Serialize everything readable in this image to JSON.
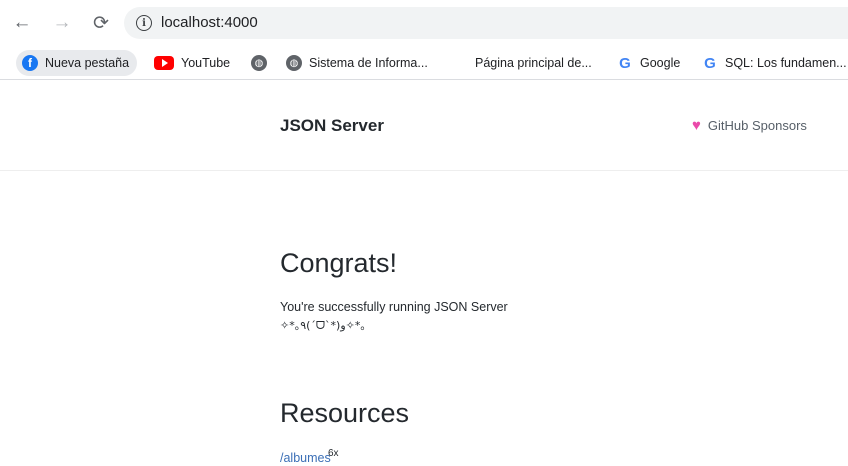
{
  "browser": {
    "url": "localhost:4000",
    "bookmarks": [
      {
        "label": "Nueva pestaña",
        "icon": "facebook-icon"
      },
      {
        "label": "YouTube",
        "icon": "youtube-icon"
      },
      {
        "label": "",
        "icon": "globe-icon"
      },
      {
        "label": "Sistema de Informa...",
        "icon": "globe-icon"
      },
      {
        "label": "Página principal de...",
        "icon": "microsoft-icon"
      },
      {
        "label": "Google",
        "icon": "google-icon"
      },
      {
        "label": "SQL: Los fundamen...",
        "icon": "google-icon"
      }
    ]
  },
  "header": {
    "brand": "JSON Server",
    "sponsors": "GitHub Sponsors"
  },
  "main": {
    "congrats_title": "Congrats!",
    "running_text": "You're successfully running JSON Server",
    "kaomoji": "✧*｡٩(ˊᗜˋ*)و✧*｡",
    "resources_title": "Resources",
    "resources": [
      {
        "path": "/albumes",
        "count": "6x"
      }
    ]
  },
  "colors": {
    "link": "#3b6fb6",
    "heart": "#ea4aaa",
    "facebook": "#1877f2",
    "youtube": "#ff0000"
  }
}
